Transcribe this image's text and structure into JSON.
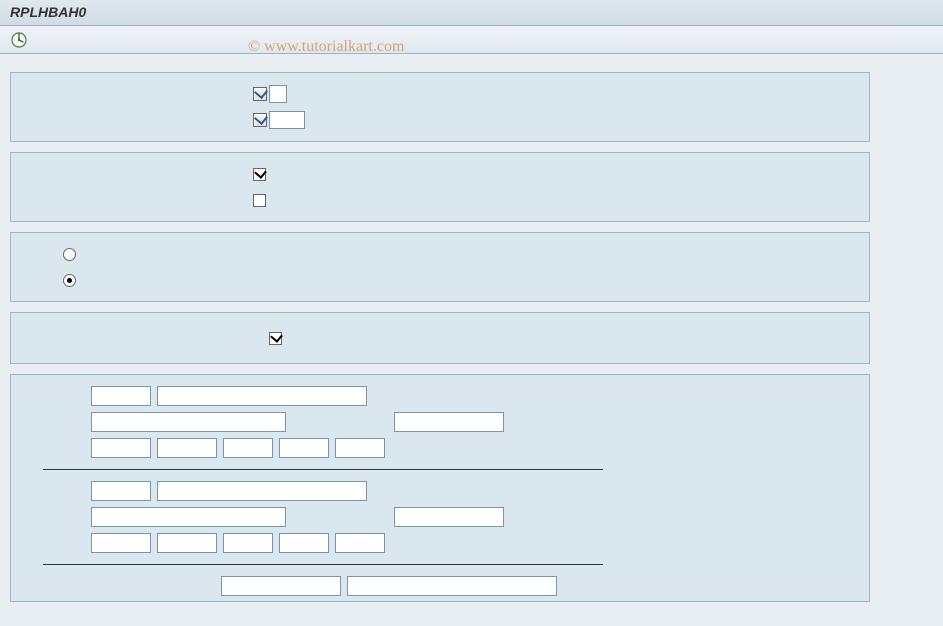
{
  "header": {
    "title": "RPLHBAH0"
  },
  "watermark": "© www.tutorialkart.com",
  "group1": {
    "cb1": {
      "checked": true,
      "value": ""
    },
    "cb2": {
      "checked": true,
      "value": ""
    }
  },
  "group2": {
    "cb1_checked": true,
    "cb2_checked": false
  },
  "group3": {
    "radio1_selected": false,
    "radio2_selected": true
  },
  "group4": {
    "cb1_checked": true
  },
  "group5": {
    "block1": {
      "r1": {
        "f1": "",
        "f2": ""
      },
      "r2": {
        "f1": "",
        "f2": ""
      },
      "r3": {
        "f1": "",
        "f2": "",
        "f3": "",
        "f4": "",
        "f5": ""
      }
    },
    "block2": {
      "r1": {
        "f1": "",
        "f2": ""
      },
      "r2": {
        "f1": "",
        "f2": ""
      },
      "r3": {
        "f1": "",
        "f2": "",
        "f3": "",
        "f4": "",
        "f5": ""
      }
    },
    "block3": {
      "r1": {
        "f1": "",
        "f2": ""
      }
    }
  }
}
